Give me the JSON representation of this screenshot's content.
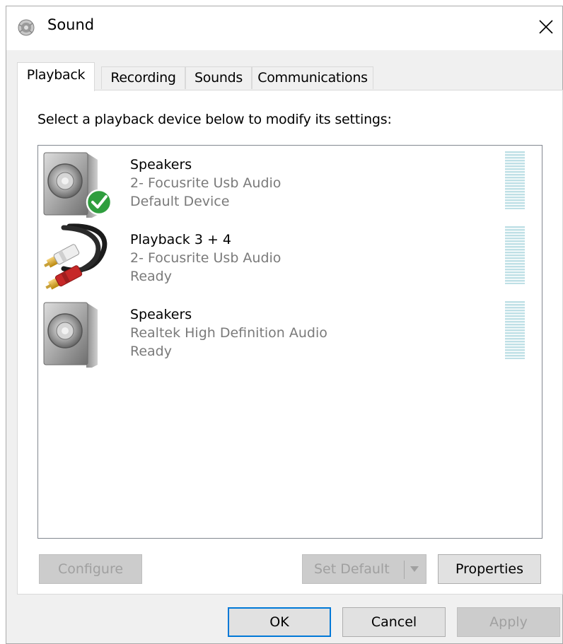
{
  "window": {
    "title": "Sound",
    "close_label": "✕"
  },
  "tabs": [
    {
      "label": "Playback",
      "active": true
    },
    {
      "label": "Recording",
      "active": false
    },
    {
      "label": "Sounds",
      "active": false
    },
    {
      "label": "Communications",
      "active": false
    }
  ],
  "playback": {
    "instruction": "Select a playback device below to modify its settings:",
    "devices": [
      {
        "name": "Speakers",
        "driver": "2- Focusrite Usb Audio",
        "status": "Default Device",
        "icon": "speaker-icon",
        "is_default": true
      },
      {
        "name": "Playback 3 + 4",
        "driver": "2- Focusrite Usb Audio",
        "status": "Ready",
        "icon": "rca-cable-icon",
        "is_default": false
      },
      {
        "name": "Speakers",
        "driver": "Realtek High Definition Audio",
        "status": "Ready",
        "icon": "speaker-icon",
        "is_default": false
      }
    ],
    "configure_label": "Configure",
    "set_default_label": "Set Default",
    "properties_label": "Properties"
  },
  "footer": {
    "ok_label": "OK",
    "cancel_label": "Cancel",
    "apply_label": "Apply"
  },
  "colors": {
    "accent": "#0078d7",
    "meter": "#bfe0e6",
    "check": "#2f9e3e"
  }
}
